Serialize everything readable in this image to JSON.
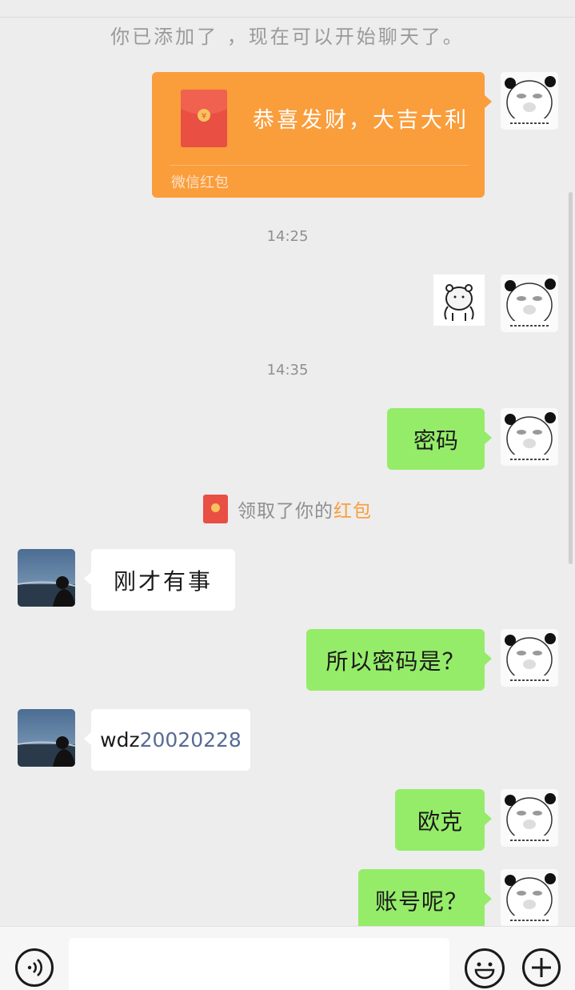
{
  "system": {
    "added_notice": "你已添加了 ，现在可以开始聊天了。"
  },
  "red_packet": {
    "title": "恭喜发财，大吉大利",
    "footer": "微信红包"
  },
  "times": [
    "14:25",
    "14:35"
  ],
  "messages": {
    "m1": "密码",
    "m2": "刚才有事",
    "m3": "所以密码是？",
    "m4_prefix": "wdz",
    "m4_number": "20020228",
    "m5": "欧克",
    "m6": "账号呢？"
  },
  "notice": {
    "text": "领取了你的",
    "link": "红包"
  },
  "icons": {
    "voice": "voice-icon",
    "emoji": "emoji-icon",
    "plus": "plus-icon",
    "red_packet": "red-packet-icon"
  },
  "colors": {
    "background": "#ededed",
    "green_bubble": "#95ec69",
    "white_bubble": "#ffffff",
    "red_packet_bg": "#fa9d3b",
    "red_packet_icon": "#e94f43",
    "link": "#fa9d3b",
    "number_link": "#576b95"
  }
}
